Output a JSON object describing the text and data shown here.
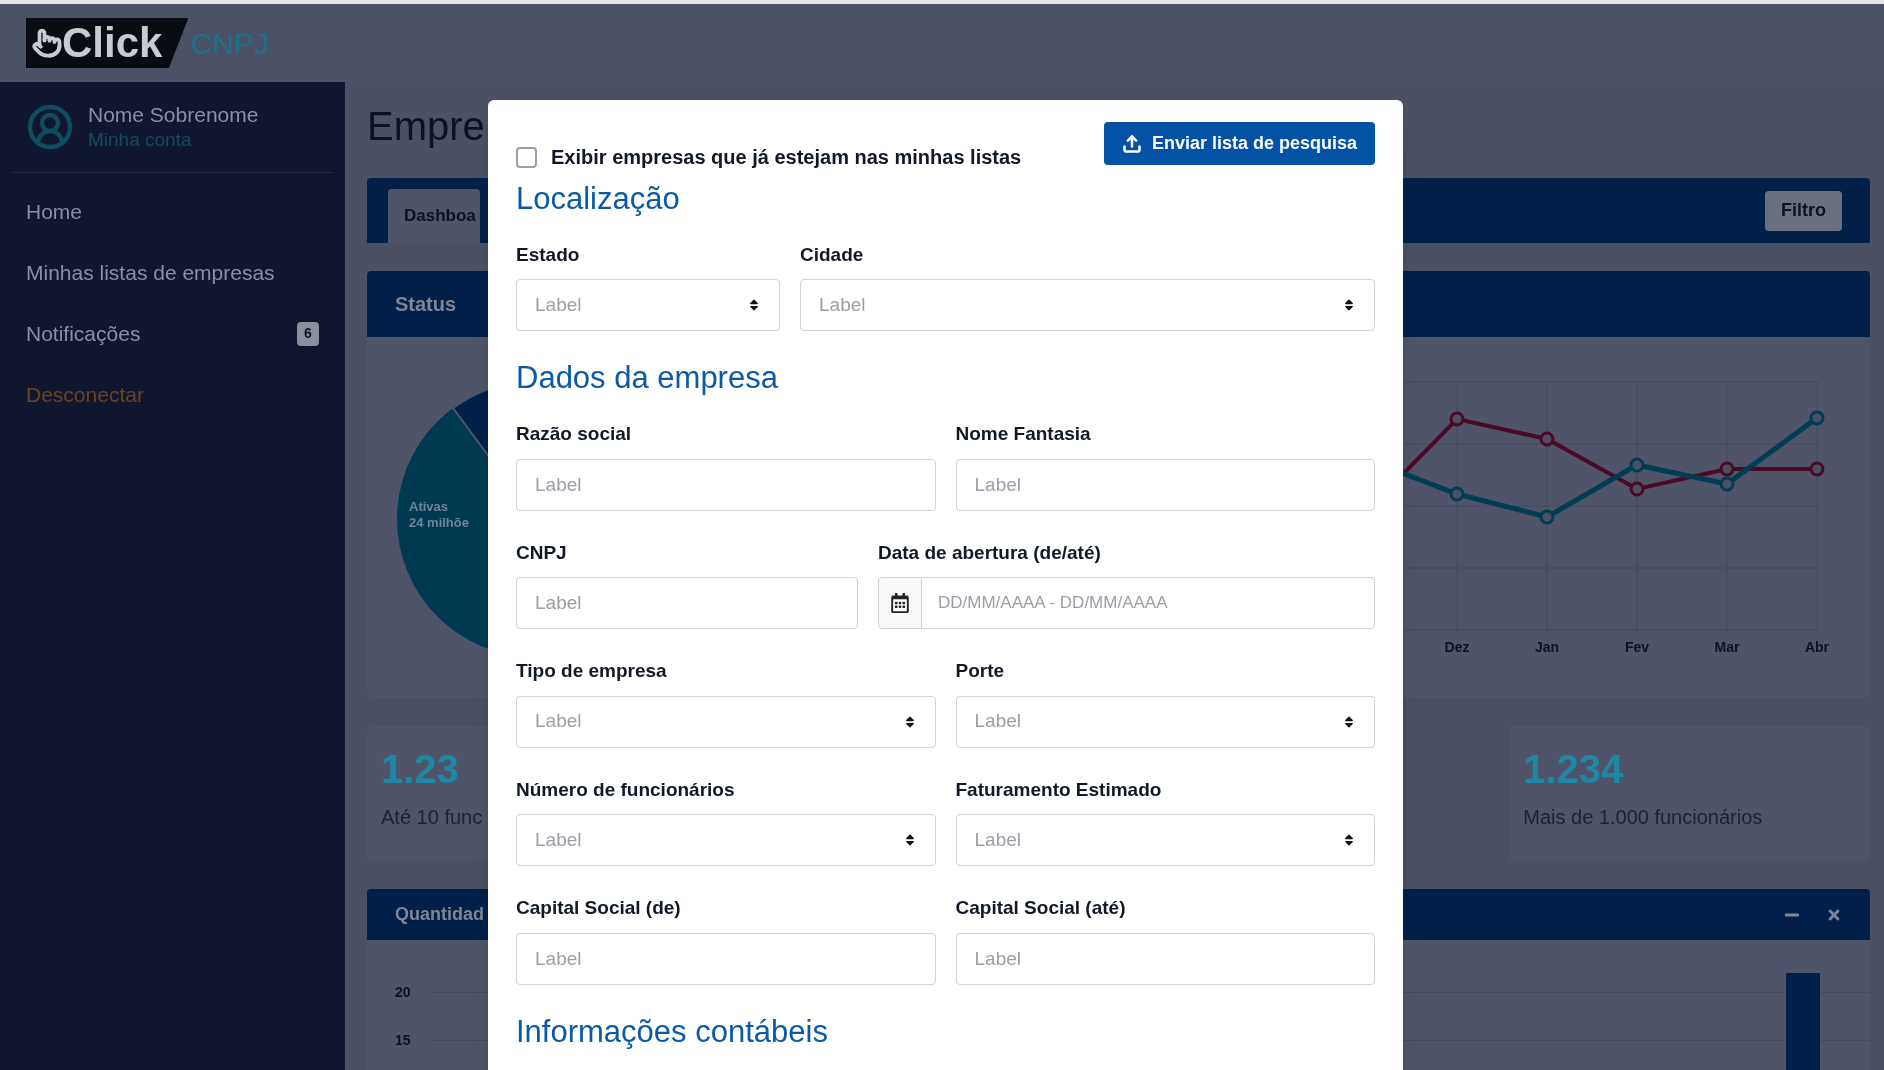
{
  "header": {
    "logo_word": "Click",
    "logo_suffix": "CNPJ"
  },
  "sidebar": {
    "user": {
      "name": "Nome Sobrenome",
      "link": "Minha conta"
    },
    "items": [
      {
        "label": "Home",
        "kind": "link"
      },
      {
        "label": "Minhas listas de empresas",
        "kind": "link"
      },
      {
        "label": "Notificações",
        "kind": "link",
        "badge": "6"
      },
      {
        "label": "Desconectar",
        "kind": "logout"
      }
    ]
  },
  "page": {
    "title": "Empre",
    "tabs": [
      {
        "label": "Dashboa",
        "selected": true
      }
    ],
    "filter_button": "Filtro",
    "status_panel": {
      "title": "Status",
      "pie_label": "Ativas",
      "pie_value": "24 milhõe"
    },
    "line_chart": {
      "months": [
        "Dez",
        "Jan",
        "Fev",
        "Mar",
        "Abr"
      ]
    },
    "stats": [
      {
        "value": "1.23",
        "label": "Até 10 func"
      },
      {
        "value": "1.234",
        "label": "Mais de 1.000 funcionários"
      }
    ],
    "quantity_panel": {
      "title": "Quantidad",
      "y_ticks": [
        "20",
        "15"
      ]
    }
  },
  "modal": {
    "show_existing": {
      "label": "Exibir empresas que já estejam nas minhas listas",
      "checked": false
    },
    "submit_button": "Enviar lista de pesquisa",
    "sections": [
      {
        "title": "Localização",
        "rows": [
          [
            {
              "label": "Estado",
              "kind": "select",
              "placeholder": "Label"
            },
            {
              "label": "Cidade",
              "kind": "select",
              "placeholder": "Label"
            }
          ]
        ]
      },
      {
        "title": "Dados da empresa",
        "rows": [
          [
            {
              "label": "Razão social",
              "kind": "text",
              "placeholder": "Label"
            },
            {
              "label": "Nome Fantasia",
              "kind": "text",
              "placeholder": "Label"
            }
          ],
          [
            {
              "label": "CNPJ",
              "kind": "text",
              "placeholder": "Label"
            },
            {
              "label": "Data de abertura (de/até)",
              "kind": "daterange",
              "placeholder": "DD/MM/AAAA - DD/MM/AAAA"
            }
          ],
          [
            {
              "label": "Tipo de empresa",
              "kind": "select",
              "placeholder": "Label"
            },
            {
              "label": "Porte",
              "kind": "select",
              "placeholder": "Label"
            }
          ],
          [
            {
              "label": "Número de funcionários",
              "kind": "select",
              "placeholder": "Label"
            },
            {
              "label": "Faturamento Estimado",
              "kind": "select",
              "placeholder": "Label"
            }
          ],
          [
            {
              "label": "Capital Social (de)",
              "kind": "text",
              "placeholder": "Label"
            },
            {
              "label": "Capital Social (até)",
              "kind": "text",
              "placeholder": "Label"
            }
          ]
        ]
      },
      {
        "title": "Informações contábeis"
      }
    ]
  }
}
